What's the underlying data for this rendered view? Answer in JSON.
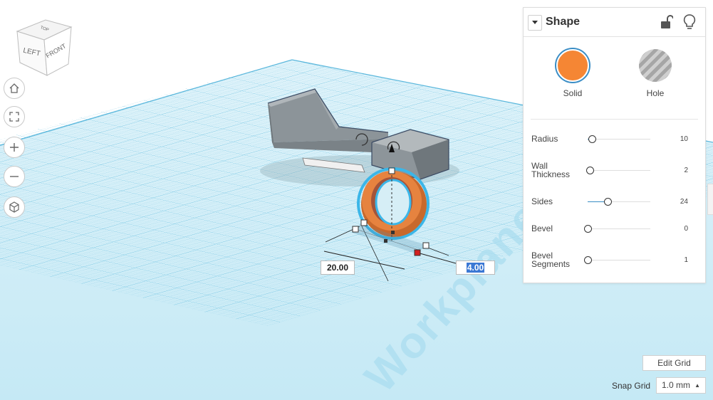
{
  "viewcube": {
    "top": "TOP",
    "left": "LEFT",
    "front": "FRONT"
  },
  "workplane": {
    "watermark": "Workplane"
  },
  "dimensions": {
    "width": "20.00",
    "depth": "4.00"
  },
  "panel": {
    "title": "Shape",
    "types": [
      {
        "label": "Solid",
        "color": "#f58634"
      },
      {
        "label": "Hole",
        "color": "#b8b8b8"
      }
    ],
    "properties": [
      {
        "label_line1": "Radius",
        "label_line2": "",
        "value": "10",
        "level": 0.07
      },
      {
        "label_line1": "Wall",
        "label_line2": "Thickness",
        "value": "2",
        "level": 0.04
      },
      {
        "label_line1": "Sides",
        "label_line2": "",
        "value": "24",
        "level": 0.32
      },
      {
        "label_line1": "Bevel",
        "label_line2": "",
        "value": "0",
        "level": 0
      },
      {
        "label_line1": "Bevel",
        "label_line2": "Segments",
        "value": "1",
        "level": 0
      }
    ]
  },
  "grid_controls": {
    "edit_grid": "Edit Grid",
    "snap_label": "Snap Grid",
    "snap_value": "1.0 mm"
  },
  "colors": {
    "accent": "#3a8dc5",
    "grid": "#7fcbe6",
    "solid": "#f58634"
  }
}
